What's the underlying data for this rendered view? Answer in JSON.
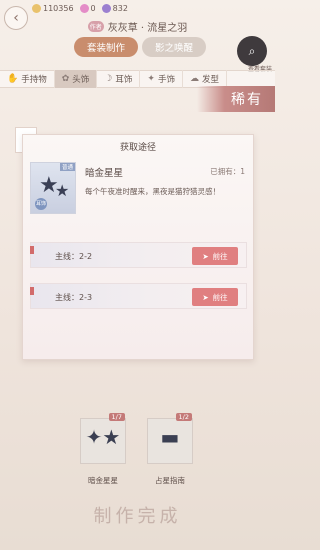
{
  "status": {
    "currency_a": "110356",
    "currency_b": "0",
    "currency_c": "832",
    "colors": {
      "gold": "#e9c26c",
      "diamond": "#e48cc7",
      "stamina": "#9b7fd0"
    }
  },
  "header": {
    "badge": "作者",
    "title": "灰灰草 · 流星之羽",
    "tabs": [
      {
        "label": "套装制作",
        "active": true
      },
      {
        "label": "影之唤醒",
        "active": false
      }
    ],
    "view_set_label": "查看套装"
  },
  "categories": [
    {
      "label": "手持物",
      "icon": "hand-icon"
    },
    {
      "label": "头饰",
      "icon": "head-icon"
    },
    {
      "label": "耳饰",
      "icon": "ear-icon"
    },
    {
      "label": "手饰",
      "icon": "glove-icon"
    },
    {
      "label": "发型",
      "icon": "hair-icon"
    }
  ],
  "rarity": "稀有",
  "popup": {
    "title": "获取途径",
    "item": {
      "name": "暗金星星",
      "owned": "已拥有：1",
      "tag": "普通",
      "sub_badge": "耳饰",
      "description": "每个午夜准时醒来，黑夜是猫狩猎灵感！"
    },
    "routes": [
      {
        "label": "主线：2-2",
        "button": "前往"
      },
      {
        "label": "主线：2-3",
        "button": "前往"
      }
    ]
  },
  "materials": [
    {
      "count": "1/7",
      "name": "暗金星星",
      "icon": "star-earring-icon"
    },
    {
      "count": "1/2",
      "name": "占星指南",
      "icon": "book-icon"
    }
  ],
  "finish_label": "制作完成"
}
